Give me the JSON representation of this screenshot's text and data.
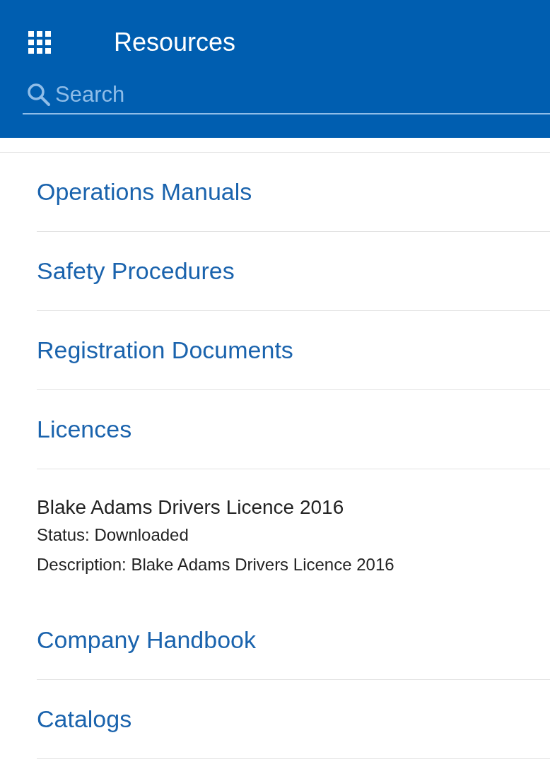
{
  "header": {
    "title": "Resources"
  },
  "search": {
    "placeholder": "Search"
  },
  "items": [
    {
      "kind": "category",
      "label": "Operations Manuals"
    },
    {
      "kind": "category",
      "label": "Safety Procedures"
    },
    {
      "kind": "category",
      "label": "Registration Documents"
    },
    {
      "kind": "category",
      "label": "Licences"
    },
    {
      "kind": "document",
      "title": "Blake Adams Drivers Licence 2016",
      "status": "Status: Downloaded",
      "description": "Description: Blake Adams Drivers Licence 2016"
    },
    {
      "kind": "category",
      "label": "Company Handbook"
    },
    {
      "kind": "category",
      "label": "Catalogs"
    }
  ]
}
